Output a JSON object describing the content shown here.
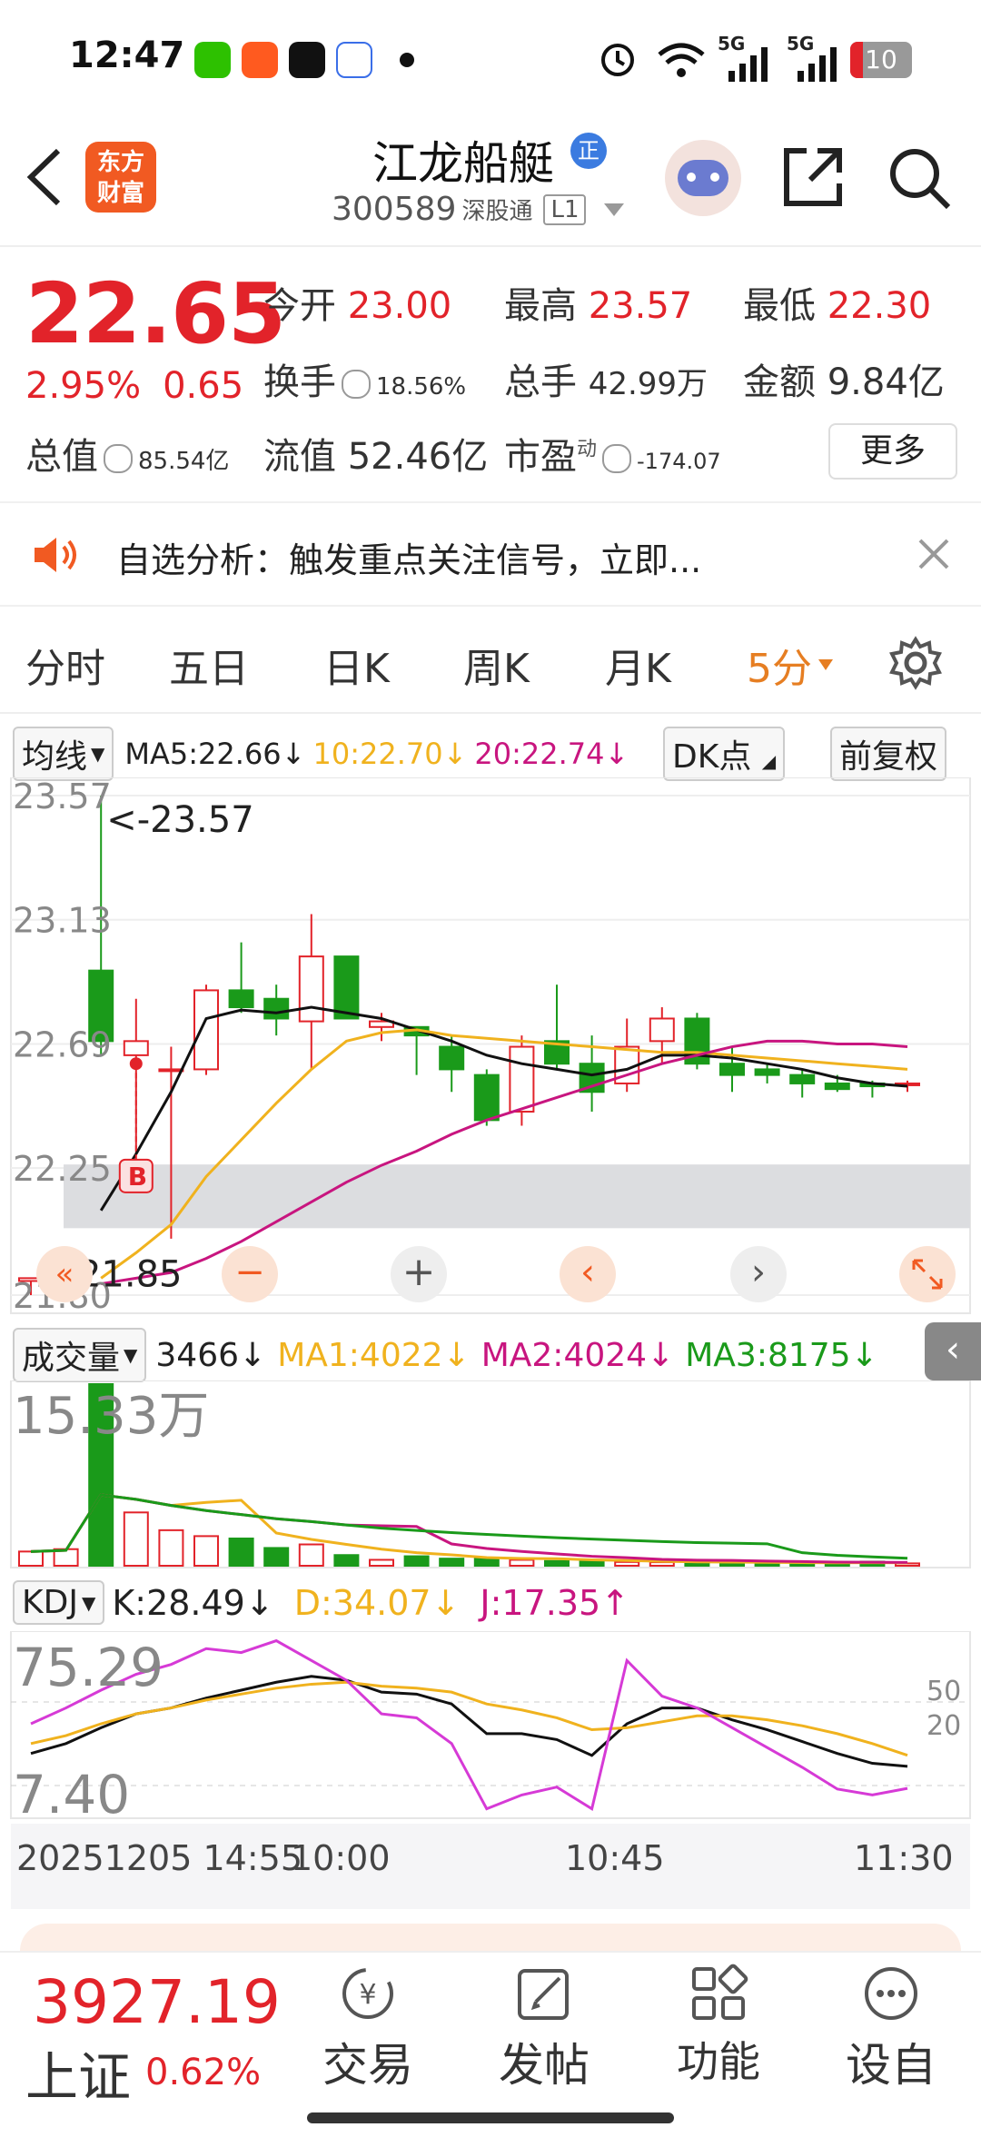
{
  "status_bar": {
    "time": "12:47",
    "battery": "10",
    "signal1": "5G",
    "signal2": "5G"
  },
  "header": {
    "logo_line1": "东方",
    "logo_line2": "财富",
    "stock_name": "江龙船艇",
    "badge": "正",
    "code": "300589",
    "market_tag": "深股通",
    "level_tag": "L1"
  },
  "quote": {
    "price": "22.65",
    "change_pct": "2.95%",
    "change_amt": "0.65",
    "open_label": "今开",
    "open": "23.00",
    "high_label": "最高",
    "high": "23.57",
    "low_label": "最低",
    "low": "22.30",
    "turnover_label": "换手",
    "turnover": "18.56%",
    "volume_label": "总手",
    "volume": "42.99万",
    "amount_label": "金额",
    "amount": "9.84亿",
    "mktcap_label": "总值",
    "mktcap": "85.54亿",
    "float_label": "流值",
    "float_cap": "52.46亿",
    "pe_label": "市盈",
    "pe_sup": "动",
    "pe": "-174.07",
    "more": "更多"
  },
  "banner": {
    "text": "自选分析：触发重点关注信号，立即..."
  },
  "tabs": [
    "分时",
    "五日",
    "日K",
    "周K",
    "月K",
    "5分"
  ],
  "active_tab": 5,
  "ma_legend": {
    "selector": "均线",
    "ma5": "MA5:22.66",
    "ma10": "10:22.70",
    "ma20": "20:22.74",
    "dk": "DK点",
    "adjust": "前复权"
  },
  "main_chart": {
    "y_labels": [
      "23.57",
      "23.13",
      "22.69",
      "22.25",
      "21.80"
    ],
    "max_note": "<-23.57",
    "min_note": "<-21.85",
    "buy_marker": "B"
  },
  "volume_legend": {
    "selector": "成交量",
    "vol": "3466",
    "ma1": "MA1:4022",
    "ma2": "MA2:4024",
    "ma3": "MA3:8175",
    "max_label": "15.33万"
  },
  "kdj_legend": {
    "selector": "KDJ",
    "k": "K:28.49",
    "d": "D:34.07",
    "j": "J:17.35",
    "top_label": "75.29",
    "bottom_label": "7.40",
    "ref_high": "50",
    "ref_low": "20"
  },
  "time_axis": [
    "20251205 14:55",
    "10:00",
    "10:45",
    "11:30"
  ],
  "bottom_nav": {
    "index_value": "3927.19",
    "index_name": "上证",
    "index_change": "0.62%",
    "items": [
      "交易",
      "发帖",
      "功能",
      "设自"
    ]
  },
  "colors": {
    "up": "#e2232a",
    "down": "#1a9a1a",
    "ma5": "#111111",
    "ma10": "#f0b21e",
    "ma20": "#c8157f",
    "accent": "#e67e22"
  },
  "chart_data": {
    "type": "candlestick",
    "candles": [
      {
        "o": 21.85,
        "h": 21.86,
        "l": 21.8,
        "c": 21.86
      },
      {
        "o": 21.85,
        "h": 21.95,
        "l": 21.8,
        "c": 21.95
      },
      {
        "o": 22.95,
        "h": 23.57,
        "l": 22.65,
        "c": 22.7
      },
      {
        "o": 22.65,
        "h": 22.85,
        "l": 22.3,
        "c": 22.7
      },
      {
        "o": 22.6,
        "h": 22.68,
        "l": 22.0,
        "c": 22.6
      },
      {
        "o": 22.6,
        "h": 22.9,
        "l": 22.58,
        "c": 22.88
      },
      {
        "o": 22.88,
        "h": 23.05,
        "l": 22.8,
        "c": 22.82
      },
      {
        "o": 22.85,
        "h": 22.9,
        "l": 22.72,
        "c": 22.78
      },
      {
        "o": 22.77,
        "h": 23.15,
        "l": 22.6,
        "c": 23.0
      },
      {
        "o": 23.0,
        "h": 23.0,
        "l": 22.78,
        "c": 22.78
      },
      {
        "o": 22.75,
        "h": 22.8,
        "l": 22.7,
        "c": 22.77
      },
      {
        "o": 22.75,
        "h": 22.75,
        "l": 22.58,
        "c": 22.72
      },
      {
        "o": 22.68,
        "h": 22.72,
        "l": 22.52,
        "c": 22.6
      },
      {
        "o": 22.58,
        "h": 22.6,
        "l": 22.4,
        "c": 22.42
      },
      {
        "o": 22.45,
        "h": 22.72,
        "l": 22.4,
        "c": 22.68
      },
      {
        "o": 22.7,
        "h": 22.9,
        "l": 22.6,
        "c": 22.62
      },
      {
        "o": 22.62,
        "h": 22.72,
        "l": 22.45,
        "c": 22.52
      },
      {
        "o": 22.55,
        "h": 22.78,
        "l": 22.52,
        "c": 22.68
      },
      {
        "o": 22.7,
        "h": 22.82,
        "l": 22.62,
        "c": 22.78
      },
      {
        "o": 22.78,
        "h": 22.8,
        "l": 22.6,
        "c": 22.62
      },
      {
        "o": 22.62,
        "h": 22.68,
        "l": 22.52,
        "c": 22.58
      },
      {
        "o": 22.6,
        "h": 22.62,
        "l": 22.55,
        "c": 22.58
      },
      {
        "o": 22.58,
        "h": 22.6,
        "l": 22.5,
        "c": 22.55
      },
      {
        "o": 22.55,
        "h": 22.58,
        "l": 22.52,
        "c": 22.53
      },
      {
        "o": 22.55,
        "h": 22.56,
        "l": 22.5,
        "c": 22.54
      },
      {
        "o": 22.55,
        "h": 22.56,
        "l": 22.52,
        "c": 22.55
      }
    ],
    "ma5": [
      null,
      null,
      22.1,
      22.3,
      22.52,
      22.78,
      22.81,
      22.8,
      22.82,
      22.8,
      22.78,
      22.74,
      22.7,
      22.65,
      22.62,
      22.6,
      22.58,
      22.6,
      22.65,
      22.65,
      22.64,
      22.62,
      22.6,
      22.57,
      22.55,
      22.54
    ],
    "ma10": [
      null,
      null,
      21.86,
      21.95,
      22.05,
      22.22,
      22.35,
      22.48,
      22.6,
      22.7,
      22.73,
      22.74,
      22.72,
      22.71,
      22.7,
      22.69,
      22.68,
      22.67,
      22.66,
      22.66,
      22.65,
      22.64,
      22.63,
      22.62,
      22.61,
      22.6
    ],
    "ma20": [
      null,
      null,
      21.84,
      21.86,
      21.88,
      21.93,
      21.99,
      22.06,
      22.13,
      22.2,
      22.26,
      22.31,
      22.37,
      22.42,
      22.46,
      22.5,
      22.54,
      22.58,
      22.62,
      22.65,
      22.68,
      22.7,
      22.7,
      22.69,
      22.69,
      22.68
    ],
    "volume": [
      12000,
      14000,
      153300,
      45000,
      30000,
      25000,
      23000,
      15000,
      18000,
      9000,
      5000,
      8000,
      6000,
      6500,
      5000,
      4000,
      3500,
      3200,
      3000,
      2800,
      2700,
      2500,
      2300,
      2000,
      3466,
      2000
    ],
    "kdj_k": [
      35,
      40,
      48,
      55,
      58,
      63,
      67,
      71,
      74,
      72,
      66,
      65,
      60,
      45,
      45,
      42,
      34,
      50,
      58,
      58,
      52,
      47,
      41,
      35,
      30,
      28.49
    ],
    "kdj_d": [
      40,
      44,
      50,
      55,
      58,
      62,
      65,
      68,
      70,
      71,
      69,
      68,
      66,
      60,
      57,
      53,
      47,
      48,
      51,
      54,
      54,
      52,
      49,
      45,
      40,
      34.07
    ],
    "kdj_j": [
      50,
      58,
      67,
      75,
      80,
      88,
      86,
      92,
      82,
      72,
      55,
      53,
      40,
      7,
      14,
      18,
      7,
      82,
      64,
      58,
      48,
      38,
      28,
      17,
      14,
      17.35
    ],
    "y_range": [
      21.8,
      23.57
    ],
    "time_labels": [
      "20251205 14:55",
      "10:00",
      "10:45",
      "11:30"
    ]
  }
}
